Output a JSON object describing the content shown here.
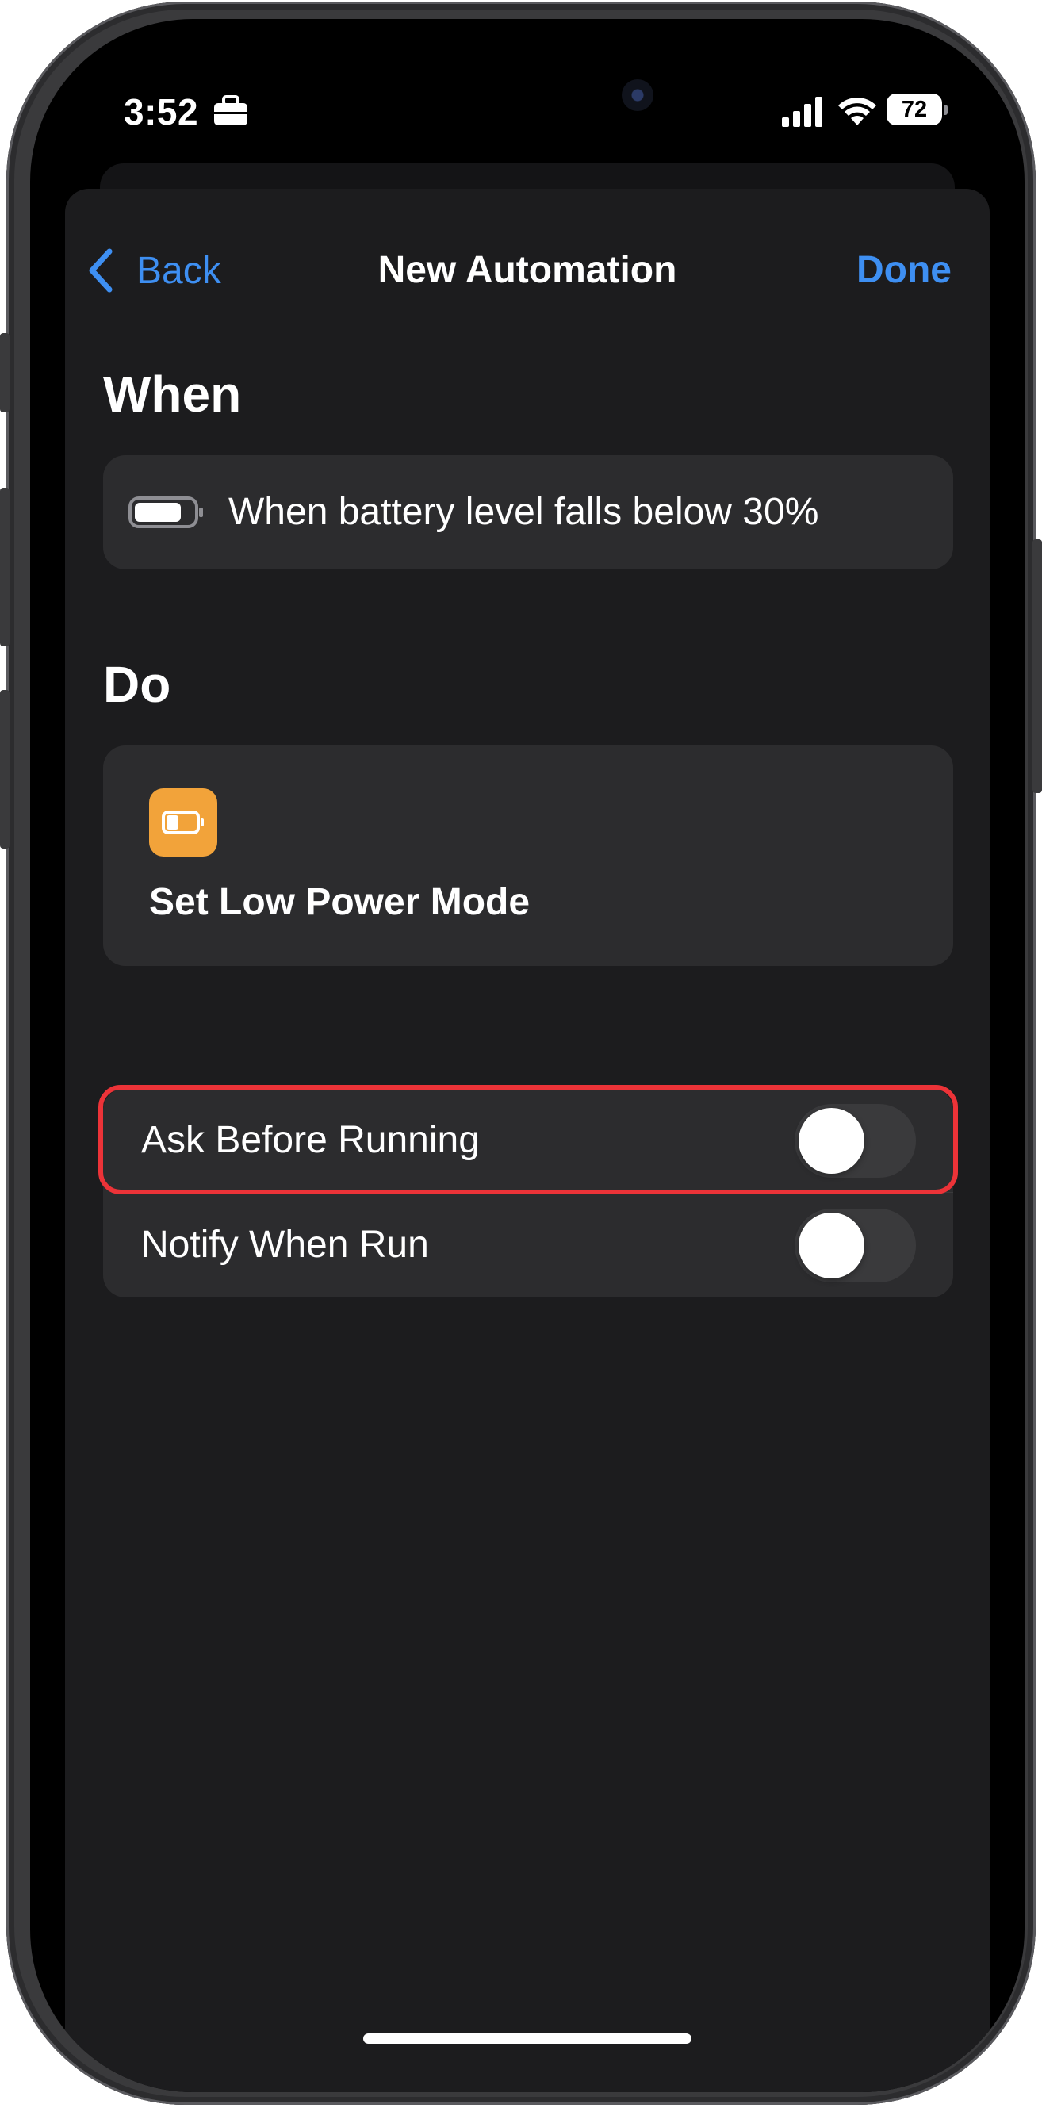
{
  "status_bar": {
    "time": "3:52",
    "battery_level": "72",
    "icons": [
      "briefcase-icon",
      "cellular-signal-icon",
      "wifi-icon",
      "battery-icon"
    ]
  },
  "nav": {
    "back_label": "Back",
    "title": "New Automation",
    "done_label": "Done"
  },
  "when": {
    "heading": "When",
    "trigger_text": "When battery level falls below 30%",
    "trigger_icon": "battery-icon"
  },
  "do": {
    "heading": "Do",
    "action_title": "Set Low Power Mode",
    "action_icon": "low-power-battery-icon",
    "action_icon_color": "#f2a33a"
  },
  "options": [
    {
      "label": "Ask Before Running",
      "on": false,
      "highlighted": true
    },
    {
      "label": "Notify When Run",
      "on": false,
      "highlighted": false
    }
  ],
  "colors": {
    "accent": "#3e8ff2",
    "background": "#1c1c1e",
    "card": "#2c2c2e",
    "highlight": "#ec3338"
  }
}
